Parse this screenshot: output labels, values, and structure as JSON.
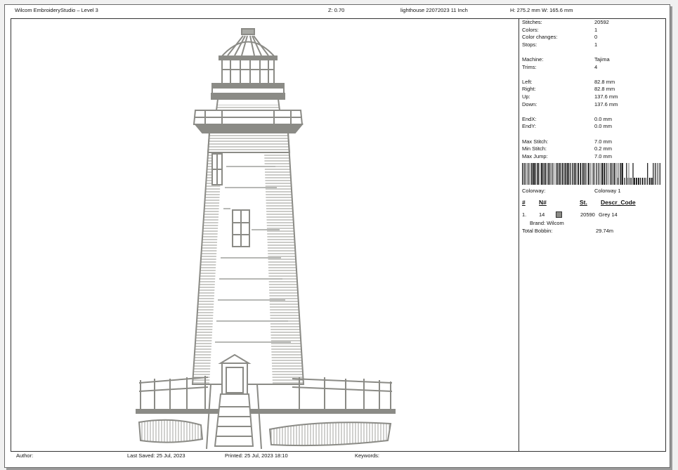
{
  "header": {
    "app_title": "Wilcom EmbroideryStudio – Level 3",
    "zoom": "Z: 0.70",
    "design_name": "lighthouse 22072023 11  Inch",
    "size": "H: 275.2 mm   W: 165.6 mm"
  },
  "stats": {
    "stitches": {
      "label": "Stitches:",
      "value": "20592"
    },
    "colors": {
      "label": "Colors:",
      "value": "1"
    },
    "color_changes": {
      "label": "Color changes:",
      "value": "0"
    },
    "stops": {
      "label": "Stops:",
      "value": "1"
    },
    "machine": {
      "label": "Machine:",
      "value": "Tajima"
    },
    "trims": {
      "label": "Trims:",
      "value": "4"
    },
    "left": {
      "label": "Left:",
      "value": "82.8 mm"
    },
    "right": {
      "label": "Right:",
      "value": "82.8 mm"
    },
    "up": {
      "label": "Up:",
      "value": "137.6 mm"
    },
    "down": {
      "label": "Down:",
      "value": "137.6 mm"
    },
    "endx": {
      "label": "EndX:",
      "value": "0.0 mm"
    },
    "endy": {
      "label": "EndY:",
      "value": "0.0 mm"
    },
    "max_stitch": {
      "label": "Max Stitch:",
      "value": "7.0 mm"
    },
    "min_stitch": {
      "label": "Min Stitch:",
      "value": "0.2 mm"
    },
    "max_jump": {
      "label": "Max Jump:",
      "value": "7.0 mm"
    },
    "colorway": {
      "label": "Colorway:",
      "value": "Colorway 1"
    }
  },
  "color_table": {
    "headers": {
      "index": "#",
      "needle": "N#",
      "stitches": "St.",
      "descr_code": "Descr_Code"
    },
    "rows": [
      {
        "index": "1.",
        "needle": "14",
        "swatch_color": "#8b8b86",
        "stitches": "20590",
        "descr": "Grey 14",
        "brand": "Brand: Wilcom"
      }
    ],
    "total_bobbin_label": "Total Bobbin:",
    "total_bobbin_value": "29.74m"
  },
  "footer": {
    "author": "Author:",
    "last_saved": "Last Saved: 25 Jul, 2023",
    "printed": "Printed:  25 Jul, 2023 18:10",
    "keywords": "Keywords:"
  },
  "colors": {
    "thread": "#8b8b86",
    "thread_dark": "#6f716b",
    "paper": "#ffffff"
  }
}
